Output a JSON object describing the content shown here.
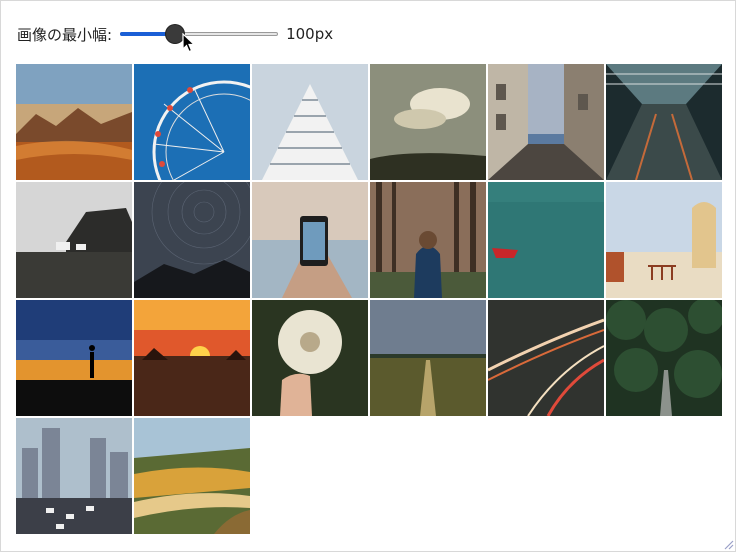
{
  "controls": {
    "label": "画像の最小幅:",
    "slider_value": "100px",
    "slider_level": 0.35
  },
  "gallery": {
    "images": [
      {
        "name": "mountain-sunset-image",
        "scene": "mountains",
        "sky": "#c7a67a",
        "ground": "#b25a1e"
      },
      {
        "name": "ferris-wheel-image",
        "scene": "ferris",
        "sky": "#1c6fb5",
        "ground": "#1c6fb5"
      },
      {
        "name": "building-angles-image",
        "scene": "building",
        "sky": "#c9d4de",
        "ground": "#f2f2f2"
      },
      {
        "name": "cloudy-landscape-image",
        "scene": "clouds",
        "sky": "#8c8f7c",
        "ground": "#2e3022"
      },
      {
        "name": "alley-street-image",
        "scene": "alley",
        "sky": "#a7b3c4",
        "ground": "#4c4640"
      },
      {
        "name": "station-escalator-image",
        "scene": "escalator",
        "sky": "#1c2b2e",
        "ground": "#3b4a4a"
      },
      {
        "name": "cliff-coast-image",
        "scene": "cliff",
        "sky": "#d6d6d6",
        "ground": "#3a3a36"
      },
      {
        "name": "star-trails-image",
        "scene": "stars",
        "sky": "#3c4450",
        "ground": "#16181c"
      },
      {
        "name": "phone-photo-image",
        "scene": "phone",
        "sky": "#d8c9bb",
        "ground": "#a3b6c4"
      },
      {
        "name": "forest-person-image",
        "scene": "forest",
        "sky": "#8a6e5a",
        "ground": "#4b5a3a"
      },
      {
        "name": "red-boat-image",
        "scene": "boat",
        "sky": "#2f7775",
        "ground": "#2a6d6a"
      },
      {
        "name": "white-village-image",
        "scene": "village",
        "sky": "#c9d7e6",
        "ground": "#e9dcc3"
      },
      {
        "name": "silhouette-dusk-image",
        "scene": "silhouette",
        "sky": "#1f3d78",
        "ground": "#0d0d0d"
      },
      {
        "name": "ocean-sunset-image",
        "scene": "sunset",
        "sky": "#e0582c",
        "ground": "#3a1a10"
      },
      {
        "name": "dandelion-image",
        "scene": "dandelion",
        "sky": "#2a3521",
        "ground": "#1c2417"
      },
      {
        "name": "field-path-image",
        "scene": "field",
        "sky": "#6f7d8f",
        "ground": "#5b5a2d"
      },
      {
        "name": "light-trails-image",
        "scene": "trails",
        "sky": "#30332f",
        "ground": "#1c1c1c"
      },
      {
        "name": "forest-road-image",
        "scene": "treetop",
        "sky": "#1f3322",
        "ground": "#203424"
      },
      {
        "name": "city-traffic-image",
        "scene": "city",
        "sky": "#aebfcc",
        "ground": "#3c3f48"
      },
      {
        "name": "autumn-river-image",
        "scene": "river",
        "sky": "#a8c3d6",
        "ground": "#8a6a34"
      }
    ]
  }
}
